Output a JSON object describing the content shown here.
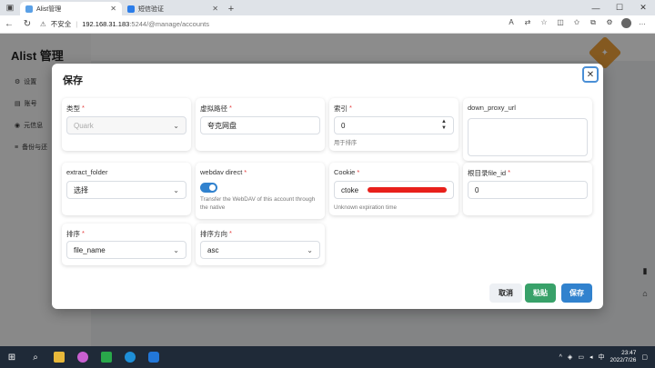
{
  "browser": {
    "tabs": [
      {
        "title": "Alist管理",
        "active": true
      },
      {
        "title": "短信验证",
        "active": false
      }
    ],
    "address": {
      "security": "不安全",
      "host": "192.168.31.183",
      "path": ":5244/@manage/accounts"
    }
  },
  "app": {
    "brand": "Alist 管理",
    "sidebar": [
      {
        "icon": "gear-icon",
        "label": "设置"
      },
      {
        "icon": "user-icon",
        "label": "账号"
      },
      {
        "icon": "info-icon",
        "label": "元信息"
      },
      {
        "icon": "database-icon",
        "label": "备份与还"
      }
    ]
  },
  "modal": {
    "title": "保存",
    "fields": {
      "type": {
        "label": "类型",
        "required": true,
        "value": "Quark"
      },
      "virtual_path": {
        "label": "虚拟路径",
        "required": true,
        "value": "夸克网盘"
      },
      "index": {
        "label": "索引",
        "required": true,
        "value": "0",
        "hint": "用于排序"
      },
      "down_proxy_url": {
        "label": "down_proxy_url",
        "required": false,
        "value": ""
      },
      "extract_folder": {
        "label": "extract_folder",
        "required": false,
        "value": "选择"
      },
      "webdav_direct": {
        "label": "webdav direct",
        "required": true,
        "on": true,
        "hint": "Transfer the WebDAV of this account through the native"
      },
      "cookie": {
        "label": "Cookie",
        "required": true,
        "value": "ctoke",
        "hint": "Unknown expiration time"
      },
      "root_folder_id": {
        "label": "根目录file_id",
        "required": true,
        "value": "0"
      },
      "order_by": {
        "label": "排序",
        "required": true,
        "value": "file_name"
      },
      "order_direction": {
        "label": "排序方向",
        "required": true,
        "value": "asc"
      }
    },
    "buttons": {
      "cancel": "取消",
      "paste": "粘贴",
      "save": "保存"
    }
  },
  "taskbar": {
    "time": "23:47",
    "date": "2022/7/26"
  },
  "colors": {
    "primary": "#3182ce",
    "success": "#38a169",
    "required": "#e53e3e",
    "redaction": "#e8201b"
  }
}
